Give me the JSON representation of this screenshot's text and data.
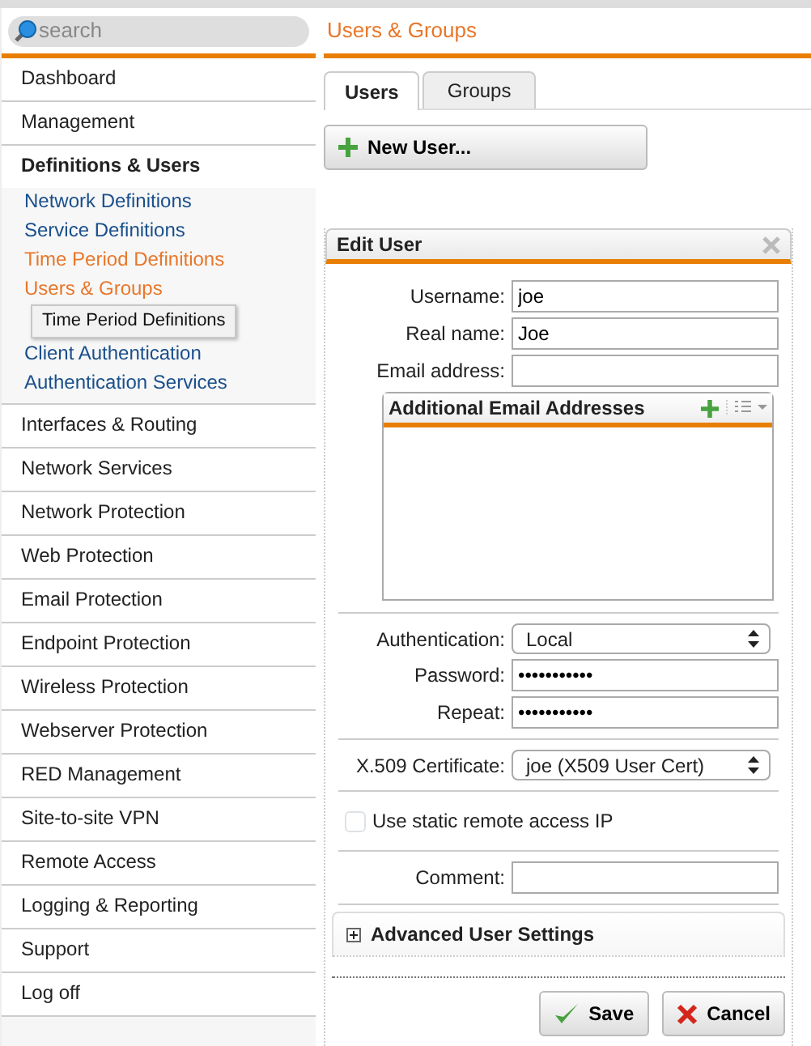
{
  "search": {
    "placeholder": "search"
  },
  "page_title": "Users & Groups",
  "sidebar": {
    "items": [
      {
        "label": "Dashboard",
        "expanded": false
      },
      {
        "label": "Management",
        "expanded": false
      },
      {
        "label": "Definitions & Users",
        "expanded": true,
        "children": [
          {
            "label": "Network Definitions",
            "selected": false,
            "hovered": false
          },
          {
            "label": "Service Definitions",
            "selected": false,
            "hovered": false
          },
          {
            "label": "Time Period Definitions",
            "selected": false,
            "hovered": true
          },
          {
            "label": "Users & Groups",
            "selected": true,
            "hovered": false
          },
          {
            "label": "Client Authentication",
            "selected": false,
            "hovered": false
          },
          {
            "label": "Authentication Services",
            "selected": false,
            "hovered": false
          }
        ]
      },
      {
        "label": "Interfaces & Routing",
        "expanded": false
      },
      {
        "label": "Network Services",
        "expanded": false
      },
      {
        "label": "Network Protection",
        "expanded": false
      },
      {
        "label": "Web Protection",
        "expanded": false
      },
      {
        "label": "Email Protection",
        "expanded": false
      },
      {
        "label": "Endpoint Protection",
        "expanded": false
      },
      {
        "label": "Wireless Protection",
        "expanded": false
      },
      {
        "label": "Webserver Protection",
        "expanded": false
      },
      {
        "label": "RED Management",
        "expanded": false
      },
      {
        "label": "Site-to-site VPN",
        "expanded": false
      },
      {
        "label": "Remote Access",
        "expanded": false
      },
      {
        "label": "Logging & Reporting",
        "expanded": false
      },
      {
        "label": "Support",
        "expanded": false
      },
      {
        "label": "Log off",
        "expanded": false
      }
    ]
  },
  "tooltip": "Time Period Definitions",
  "tabs": [
    {
      "label": "Users",
      "selected": true
    },
    {
      "label": "Groups",
      "selected": false
    }
  ],
  "new_button": "New User...",
  "edit_user": {
    "title": "Edit User",
    "sections": [
      {
        "fields": [
          {
            "kind": "text",
            "label": "Username:",
            "value": "joe"
          },
          {
            "kind": "text",
            "label": "Real name:",
            "value": "Joe"
          },
          {
            "kind": "text",
            "label": "Email address:"
          },
          {
            "kind": "list",
            "title": "Additional Email Addresses"
          }
        ]
      },
      {
        "fields": [
          {
            "kind": "select",
            "label": "Authentication:",
            "value": "Local"
          },
          {
            "kind": "password",
            "label": "Password:",
            "value": "•••••••••••"
          },
          {
            "kind": "password",
            "label": "Repeat:",
            "value": "•••••••••••"
          }
        ]
      },
      {
        "fields": [
          {
            "kind": "select",
            "label": "X.509 Certificate:",
            "value": "joe (X509 User Cert)"
          }
        ]
      },
      {
        "fields": [
          {
            "kind": "checkbox",
            "label": "Use static remote access IP",
            "checked": false
          }
        ]
      },
      {
        "fields": [
          {
            "kind": "text",
            "label": "Comment:"
          }
        ]
      }
    ],
    "advanced": {
      "label": "Advanced User Settings",
      "expanded": false
    },
    "buttons": [
      {
        "kind": "save",
        "label": "Save"
      },
      {
        "kind": "cancel",
        "label": "Cancel"
      }
    ]
  }
}
